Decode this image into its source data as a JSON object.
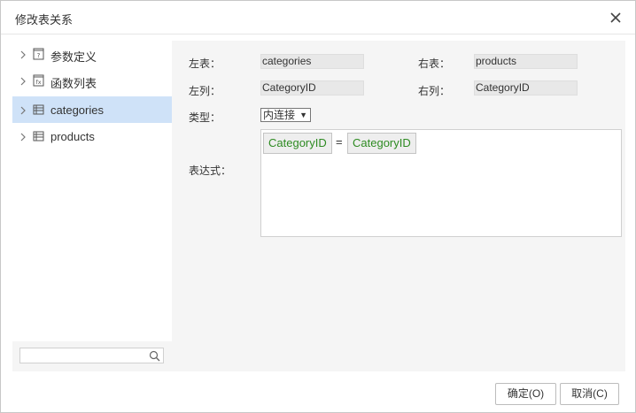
{
  "dialog": {
    "title": "修改表关系"
  },
  "tree": {
    "items": [
      {
        "label": "参数定义",
        "icon": "parameter-icon"
      },
      {
        "label": "函数列表",
        "icon": "function-icon"
      },
      {
        "label": "categories",
        "icon": "table-icon",
        "selected": true
      },
      {
        "label": "products",
        "icon": "table-icon"
      }
    ]
  },
  "search": {
    "value": "",
    "placeholder": ""
  },
  "form": {
    "left_table_label": "左表：",
    "left_table_value": "categories",
    "right_table_label": "右表：",
    "right_table_value": "products",
    "left_column_label": "左列：",
    "left_column_value": "CategoryID",
    "right_column_label": "右列：",
    "right_column_value": "CategoryID",
    "type_label": "类型：",
    "type_value": "内连接",
    "expression_label": "表达式：",
    "expression": {
      "left": "CategoryID",
      "operator": "=",
      "right": "CategoryID"
    }
  },
  "footer": {
    "ok_label": "确定(O)",
    "cancel_label": "取消(C)"
  },
  "colors": {
    "selected_row": "#cfe2f8",
    "token_text": "#2e8b22",
    "panel_bg": "#f5f5f5"
  }
}
